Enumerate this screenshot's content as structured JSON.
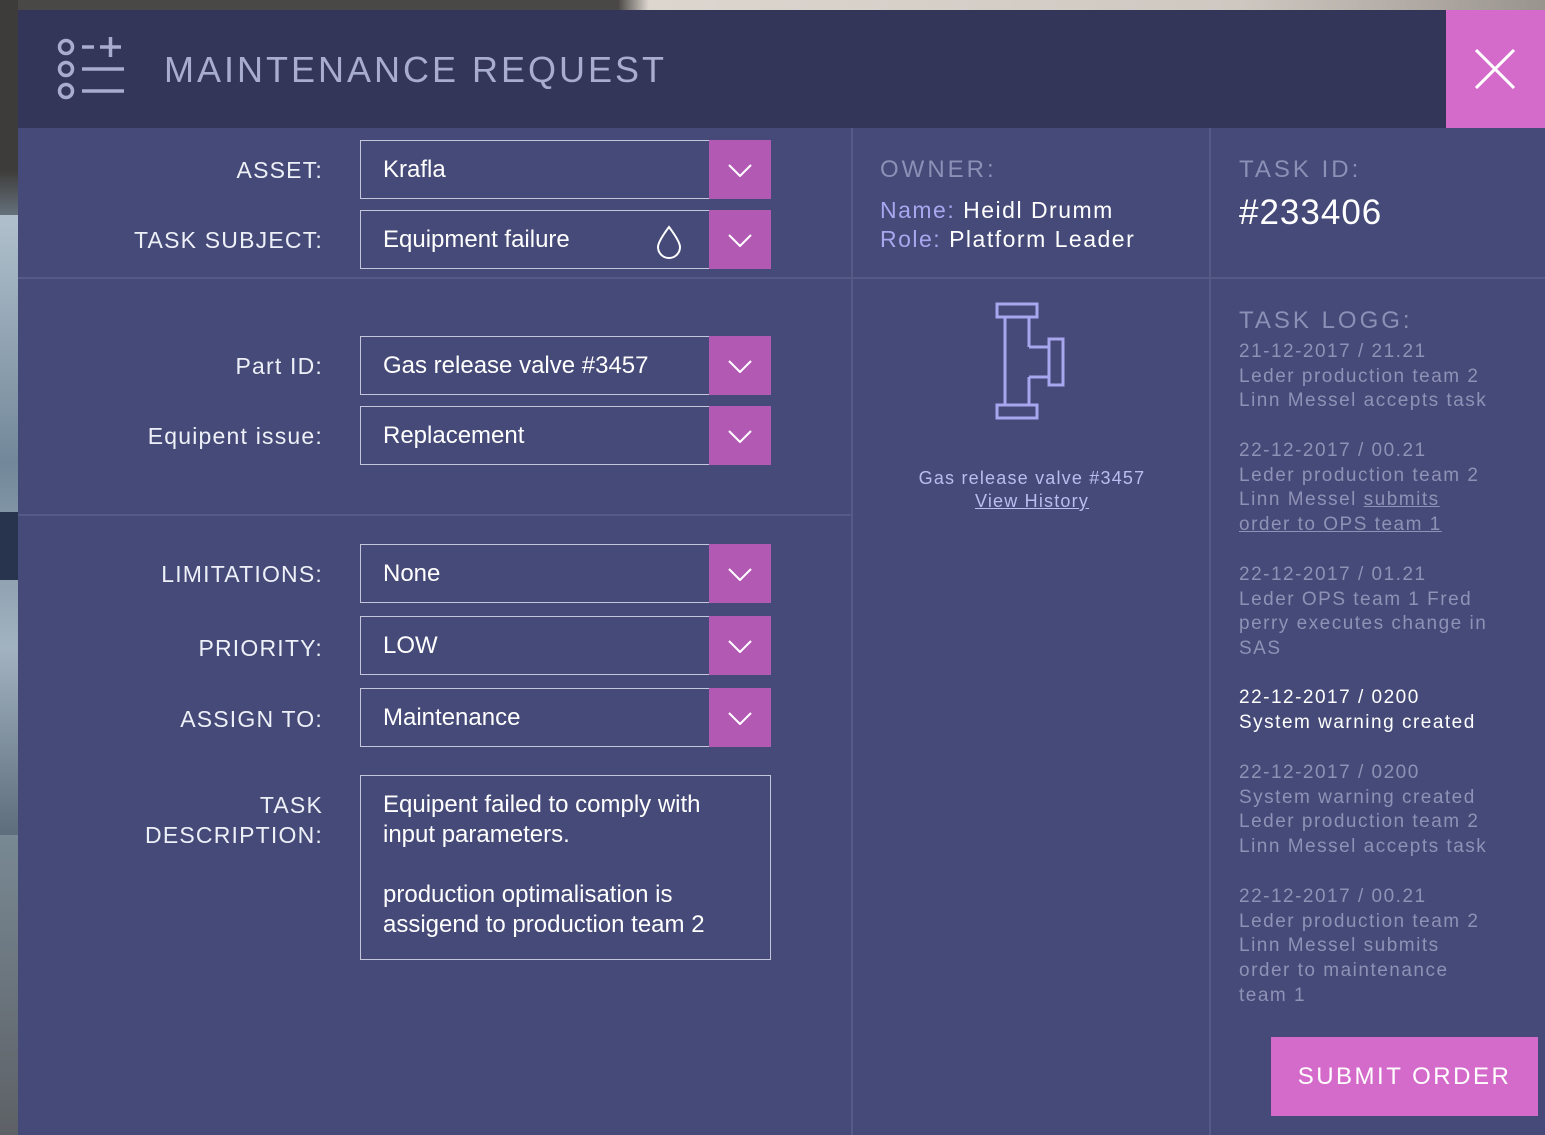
{
  "header": {
    "title": "MAINTENANCE REQUEST",
    "icon": "task-list-add-icon",
    "close_icon": "close-icon"
  },
  "form": {
    "asset": {
      "label": "ASSET:",
      "value": "Krafla"
    },
    "task_subject": {
      "label": "TASK SUBJECT:",
      "value": "Equipment failure",
      "icon": "water-drop-icon"
    },
    "part_id": {
      "label": "Part ID:",
      "value": "Gas release valve #3457"
    },
    "equipment_issue": {
      "label": "Equipent issue:",
      "value": "Replacement"
    },
    "limitations": {
      "label": "LIMITATIONS:",
      "value": "None"
    },
    "priority": {
      "label": "PRIORITY:",
      "value": "LOW"
    },
    "assign_to": {
      "label": "ASSIGN TO:",
      "value": "Maintenance"
    },
    "task_description": {
      "label_line1": "TASK",
      "label_line2": "DESCRIPTION:",
      "paragraph1": "Equipent failed to comply with input parameters.",
      "paragraph2": "production optimalisation is assigend to production team 2"
    }
  },
  "owner": {
    "heading": "OWNER:",
    "name_label": "Name:",
    "name": "Heidl Drumm",
    "role_label": "Role:",
    "role": "Platform Leader"
  },
  "task": {
    "heading": "TASK ID:",
    "id": "#233406"
  },
  "part": {
    "icon": "pipe-tee-icon",
    "name": "Gas release valve #3457",
    "history_link": "View History"
  },
  "log": {
    "heading": "TASK LOGG:",
    "entries": [
      {
        "time": "21-12-2017 / 21.21",
        "line1": "Leder production team 2",
        "line2": "Linn Messel accepts task"
      },
      {
        "time": "22-12-2017 / 00.21",
        "line1": "Leder production team 2",
        "line2_prefix": "Linn Messel",
        "line2_link": "submits",
        "line3_link": "order to OPS team 1"
      },
      {
        "time": "22-12-2017 / 01.21",
        "line1": "Leder OPS team 1 Fred",
        "line2": "perry executes change in",
        "line3": "SAS"
      },
      {
        "time": "22-12-2017 / 0200",
        "line1": "System warning created"
      },
      {
        "time": "22-12-2017 / 0200",
        "line1": "System warning created",
        "line2": "Leder production team 2",
        "line3": "Linn Messel accepts task"
      },
      {
        "time": "22-12-2017 / 00.21",
        "line1": "Leder production team 2",
        "line2": "Linn Messel submits",
        "line3": "order to maintenance",
        "line4": "team 1"
      }
    ]
  },
  "actions": {
    "submit_label": "SUBMIT ORDER"
  },
  "colors": {
    "panel": "#454a78",
    "header": "#343659",
    "accent": "#d46bca",
    "dropdown_button": "#b25ab3",
    "muted_text": "#8e92b6"
  }
}
